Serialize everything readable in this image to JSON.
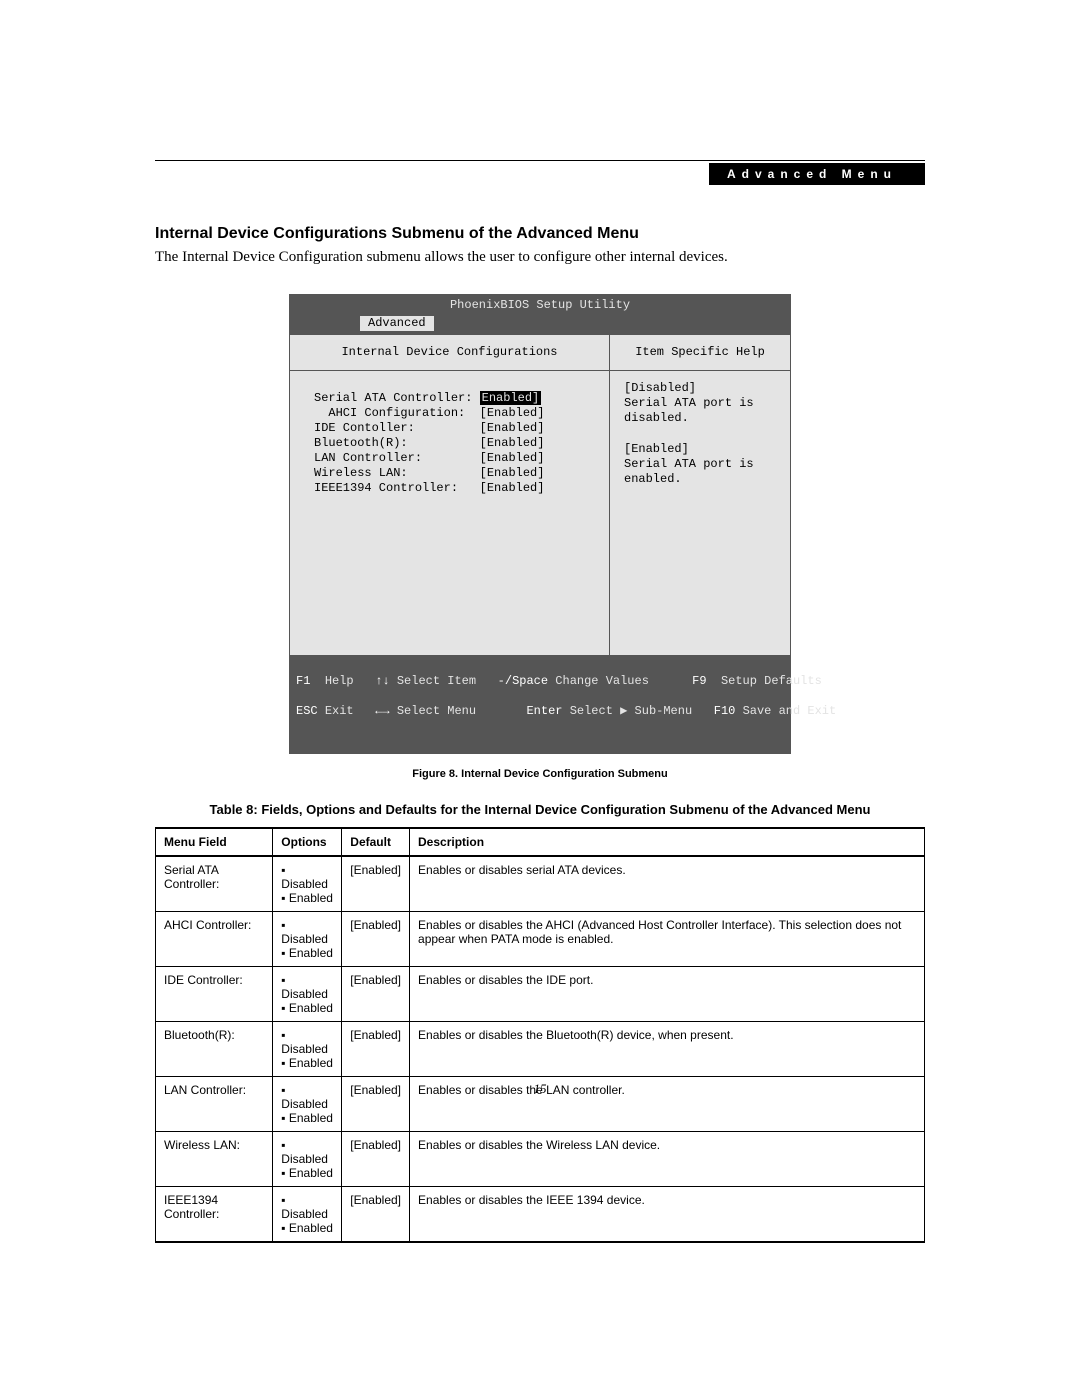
{
  "header": {
    "tab_label": "Advanced Menu"
  },
  "section": {
    "title": "Internal Device Configurations Submenu of the Advanced Menu",
    "intro": "The Internal Device Configuration submenu allows the user to configure other internal devices."
  },
  "bios": {
    "title": "PhoenixBIOS Setup Utility",
    "active_tab": "Advanced",
    "left_title": "Internal Device Configurations",
    "right_title": "Item Specific Help",
    "settings": [
      {
        "label": "Serial ATA Controller:",
        "value": "Enabled]",
        "highlight": true
      },
      {
        "label": "  AHCI Configuration:",
        "value": "[Enabled]",
        "highlight": false
      },
      {
        "label": "IDE Contoller:",
        "value": "[Enabled]",
        "highlight": false
      },
      {
        "label": "Bluetooth(R):",
        "value": "[Enabled]",
        "highlight": false
      },
      {
        "label": "LAN Controller:",
        "value": "[Enabled]",
        "highlight": false
      },
      {
        "label": "Wireless LAN:",
        "value": "[Enabled]",
        "highlight": false
      },
      {
        "label": "IEEE1394 Controller:",
        "value": "[Enabled]",
        "highlight": false
      }
    ],
    "help": [
      "[Disabled]\nSerial ATA port is disabled.",
      "[Enabled]\nSerial ATA port is enabled."
    ],
    "footer": {
      "f1": "F1",
      "help": "Help",
      "arrows_ud": "↑↓",
      "select_item": "Select Item",
      "minus_space": "-/Space",
      "change_values": "Change Values",
      "f9": "F9",
      "setup_defaults": "Setup Defaults",
      "esc": "ESC",
      "exit": "Exit",
      "arrows_lr": "←→",
      "select_menu": "Select Menu",
      "enter": "Enter",
      "select_submenu": "Select ▶ Sub-Menu",
      "f10": "F10",
      "save_exit": "Save and Exit"
    }
  },
  "figure_caption": "Figure 8.   Internal Device Configuration Submenu",
  "table_title": "Table 8: Fields, Options and Defaults for the Internal Device Configuration Submenu of the Advanced Menu",
  "table": {
    "headers": [
      "Menu Field",
      "Options",
      "Default",
      "Description"
    ],
    "rows": [
      {
        "field": "Serial ATA Controller:",
        "options": [
          "Disabled",
          "Enabled"
        ],
        "default": "[Enabled]",
        "desc": "Enables or disables serial ATA devices."
      },
      {
        "field": "AHCI Controller:",
        "options": [
          "Disabled",
          "Enabled"
        ],
        "default": "[Enabled]",
        "desc": "Enables or disables the AHCI (Advanced Host Controller Interface). This selection does not appear when PATA mode is enabled."
      },
      {
        "field": "IDE Controller:",
        "options": [
          "Disabled",
          "Enabled"
        ],
        "default": "[Enabled]",
        "desc": "Enables or disables the IDE port."
      },
      {
        "field": "Bluetooth(R):",
        "options": [
          "Disabled",
          "Enabled"
        ],
        "default": "[Enabled]",
        "desc": "Enables or disables the Bluetooth(R) device, when present."
      },
      {
        "field": "LAN Controller:",
        "options": [
          "Disabled",
          "Enabled"
        ],
        "default": "[Enabled]",
        "desc": "Enables or disables the LAN controller."
      },
      {
        "field": "Wireless LAN:",
        "options": [
          "Disabled",
          "Enabled"
        ],
        "default": "[Enabled]",
        "desc": "Enables or disables the Wireless LAN device."
      },
      {
        "field": "IEEE1394 Controller:",
        "options": [
          "Disabled",
          "Enabled"
        ],
        "default": "[Enabled]",
        "desc": "Enables or disables the IEEE 1394 device."
      }
    ]
  },
  "page_number": "15"
}
